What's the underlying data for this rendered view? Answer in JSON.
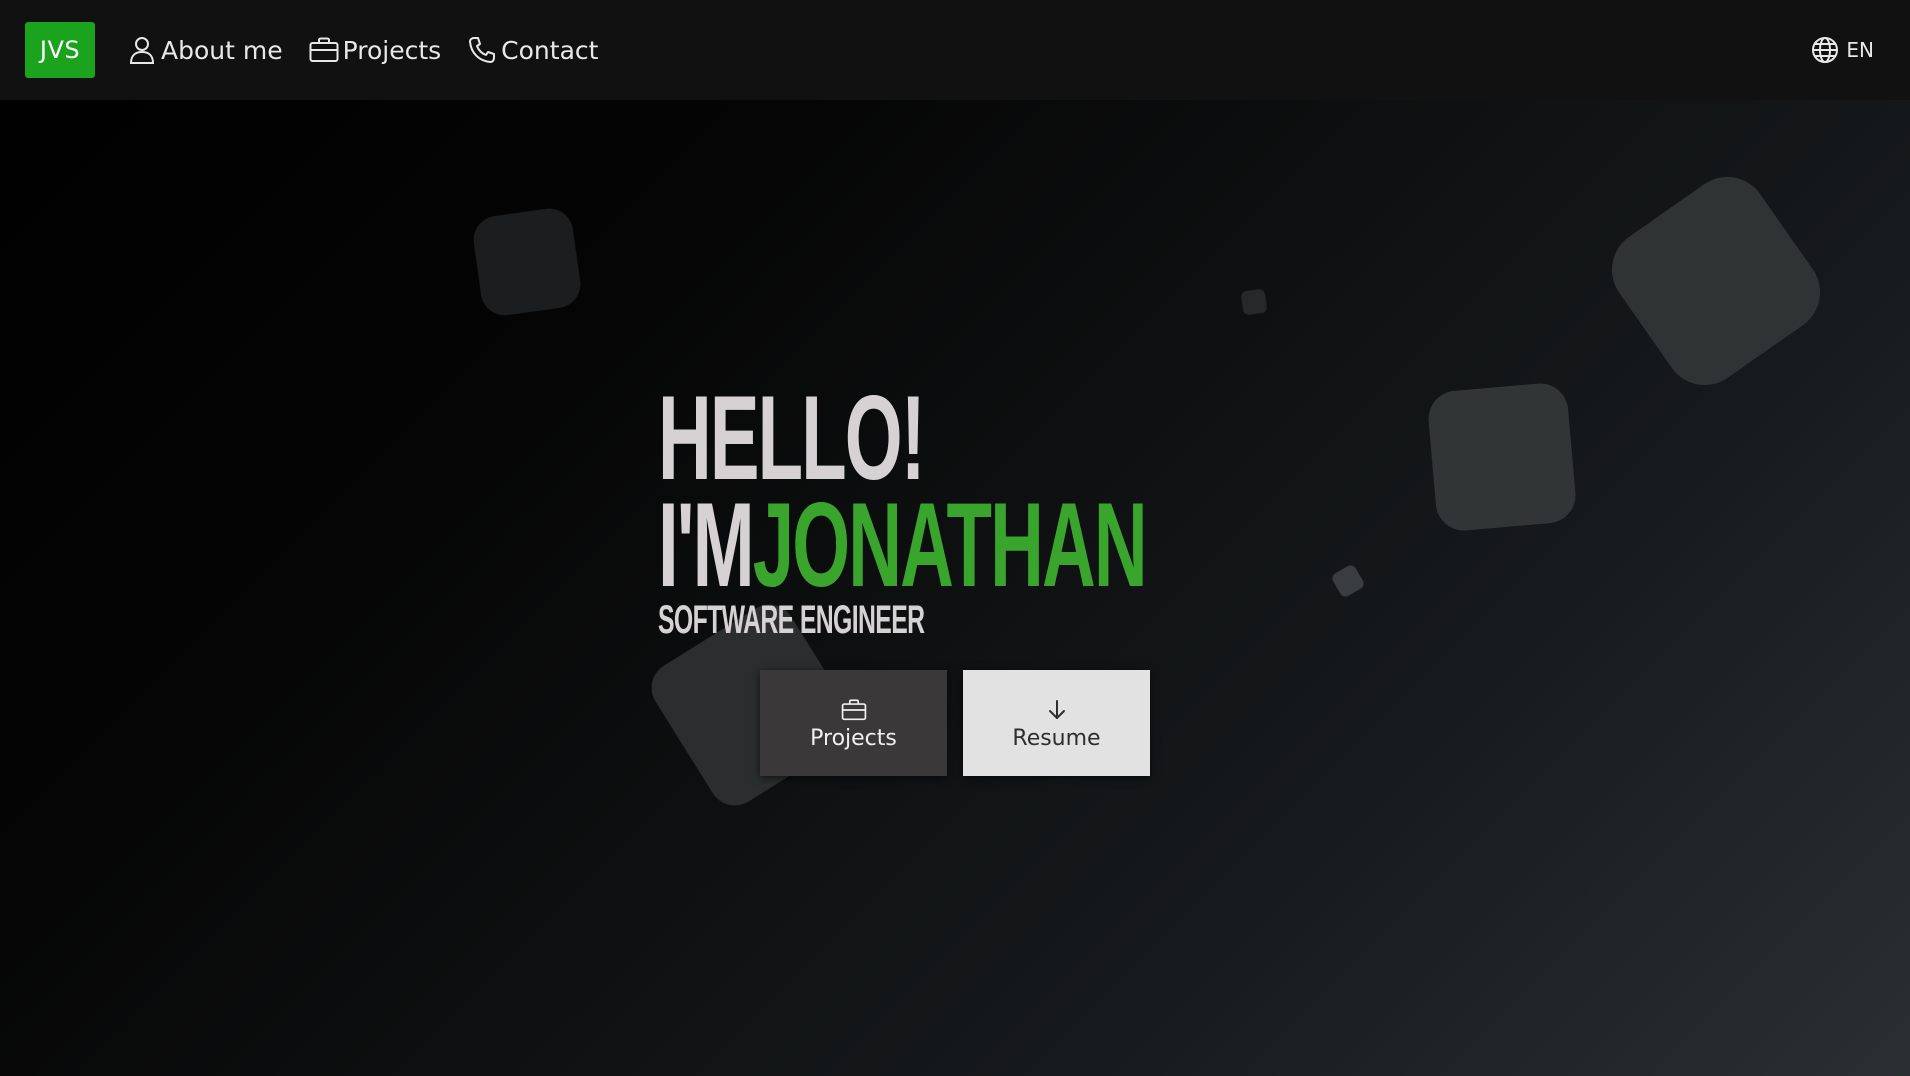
{
  "navbar": {
    "logo": "JVS",
    "items": [
      {
        "label": "About me",
        "icon": "user-icon"
      },
      {
        "label": "Projects",
        "icon": "briefcase-icon"
      },
      {
        "label": "Contact",
        "icon": "phone-icon"
      }
    ],
    "language": {
      "label": "EN",
      "icon": "globe-icon"
    }
  },
  "hero": {
    "greeting": "HELLO!",
    "intro": "I'M",
    "name": "JONATHAN",
    "subtitle": "SOFTWARE ENGINEER"
  },
  "buttons": {
    "projects": {
      "label": "Projects",
      "icon": "briefcase-icon"
    },
    "resume": {
      "label": "Resume",
      "icon": "arrow-down-icon"
    }
  },
  "colors": {
    "accent": "#1ba31d",
    "name": "#3aa52c",
    "hero_text": "#d6d2d3",
    "navbar": "#111111"
  }
}
